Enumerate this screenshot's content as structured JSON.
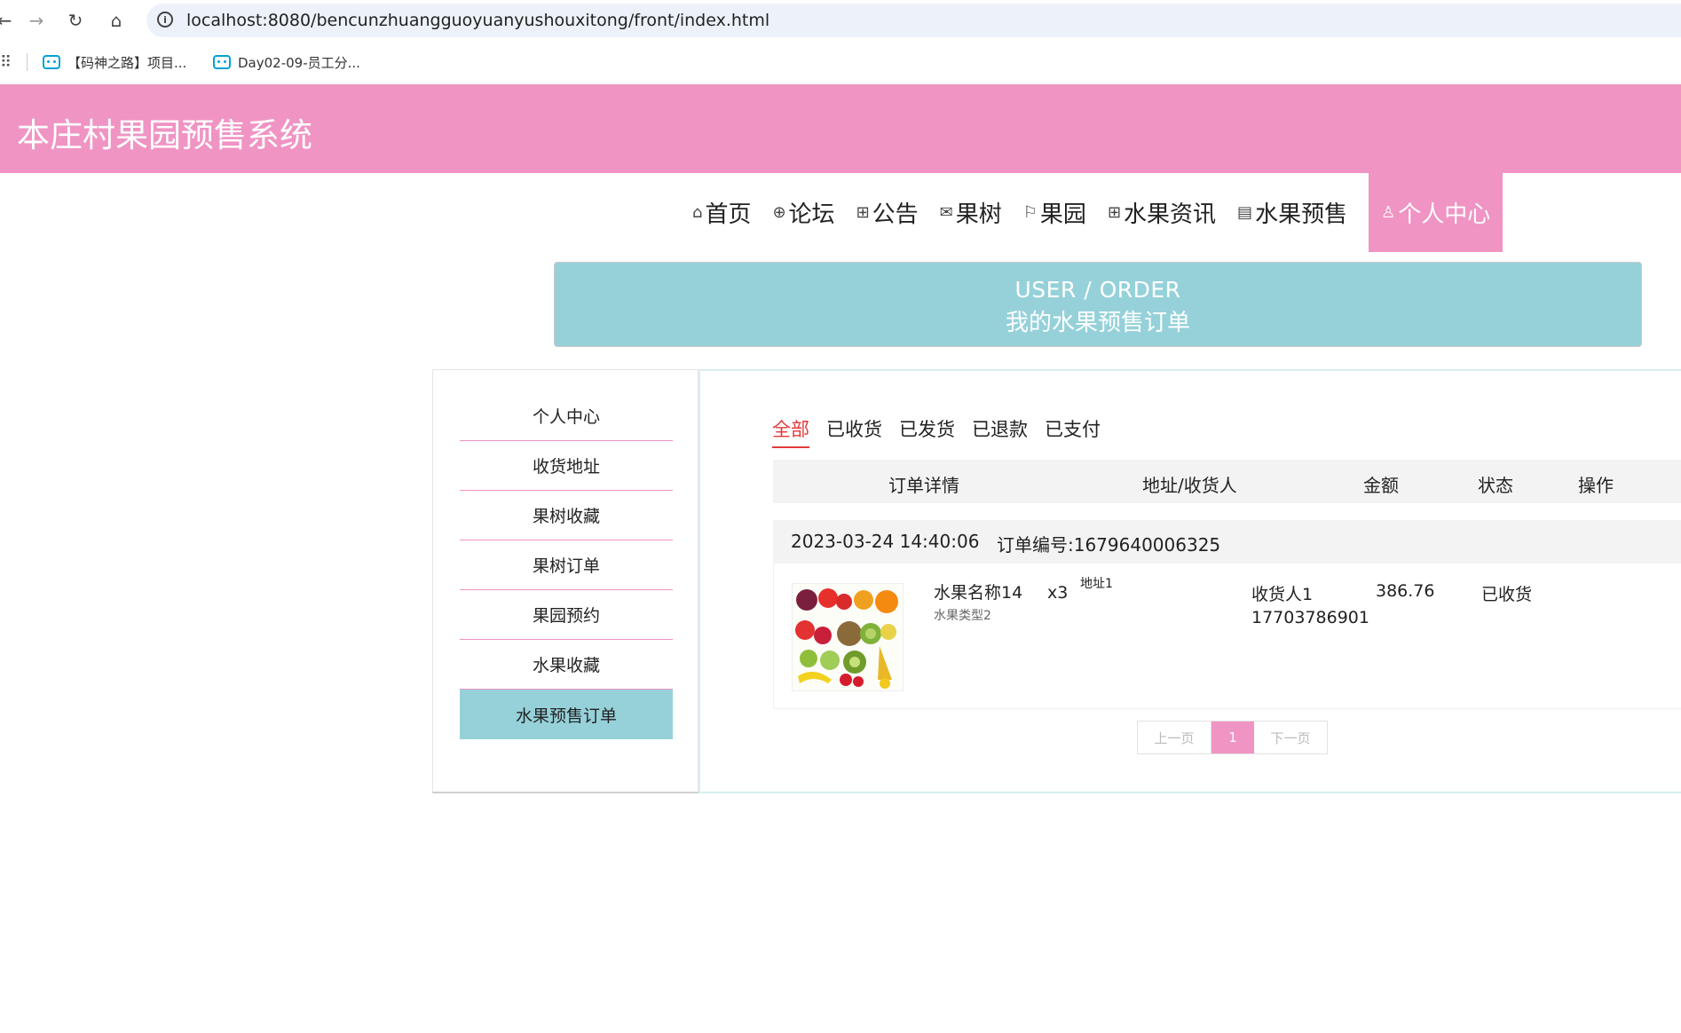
{
  "browser": {
    "url": "localhost:8080/bencunzhuangguoyuanyushouxitong/front/index.html",
    "bookmarks": [
      "【码神之路】项目...",
      "Day02-09-员工分..."
    ]
  },
  "header": {
    "title": "本庄村果园预售系统"
  },
  "nav": {
    "items": [
      {
        "label": "首页",
        "icon": "home-icon"
      },
      {
        "label": "论坛",
        "icon": "globe-icon"
      },
      {
        "label": "公告",
        "icon": "gift-icon"
      },
      {
        "label": "果树",
        "icon": "mail-icon"
      },
      {
        "label": "果园",
        "icon": "flag-icon"
      },
      {
        "label": "水果资讯",
        "icon": "apps-icon"
      },
      {
        "label": "水果预售",
        "icon": "clipboard-icon"
      },
      {
        "label": "个人中心",
        "icon": "user-icon"
      }
    ]
  },
  "banner": {
    "en": "USER / ORDER",
    "cn": "我的水果预售订单"
  },
  "sidebar": {
    "items": [
      "个人中心",
      "收货地址",
      "果树收藏",
      "果树订单",
      "果园预约",
      "水果收藏",
      "水果预售订单"
    ],
    "active_index": 6
  },
  "tabs": {
    "items": [
      "全部",
      "已收货",
      "已发货",
      "已退款",
      "已支付"
    ],
    "active_index": 0
  },
  "table": {
    "headers": [
      "订单详情",
      "地址/收货人",
      "金额",
      "状态",
      "操作"
    ]
  },
  "order": {
    "time": "2023-03-24 14:40:06",
    "number": "订单编号:1679640006325",
    "fruit_name": "水果名称14",
    "fruit_type": "水果类型2",
    "quantity": "x3",
    "address": "地址1",
    "receiver": "收货人1",
    "phone": "17703786901",
    "amount": "386.76",
    "status": "已收货"
  },
  "pager": {
    "prev": "上一页",
    "current": "1",
    "next": "下一页"
  },
  "colors": {
    "accent_pink": "#f094c4",
    "accent_teal": "#96d1da",
    "tab_active": "#e23a3a"
  }
}
